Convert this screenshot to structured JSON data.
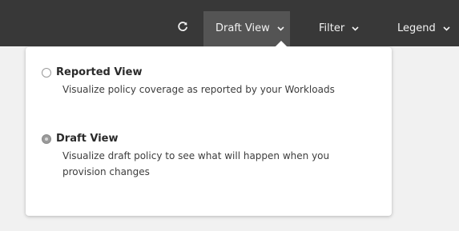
{
  "toolbar": {
    "refresh_icon": "refresh-icon",
    "view_label": "Draft View",
    "filter_label": "Filter",
    "legend_label": "Legend",
    "chevron_icon": "chevron-down-icon"
  },
  "dropdown": {
    "options": [
      {
        "title": "Reported View",
        "description": "Visualize policy coverage as reported by your Workloads",
        "selected": false
      },
      {
        "title": "Draft View",
        "description": "Visualize draft policy to see what will happen when you provision changes",
        "selected": true
      }
    ]
  },
  "colors": {
    "toolbar_bg": "#383838",
    "active_tab_bg": "#545454",
    "dropdown_bg": "#ffffff",
    "page_bg": "#f1f1f1"
  }
}
